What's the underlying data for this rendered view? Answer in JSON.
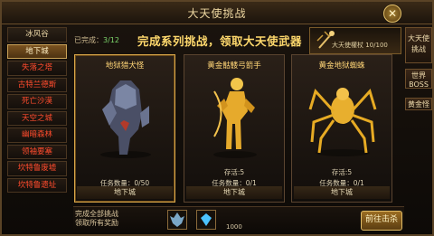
{
  "window": {
    "title": "大天使挑战"
  },
  "sidebar": {
    "items": [
      {
        "label": "冰风谷"
      },
      {
        "label": "地下城"
      },
      {
        "label": "失落之塔"
      },
      {
        "label": "古特兰德斯"
      },
      {
        "label": "死亡沙漠"
      },
      {
        "label": "天空之城"
      },
      {
        "label": "幽暗森林"
      },
      {
        "label": "领袖要塞"
      },
      {
        "label": "坎特鲁废墟"
      },
      {
        "label": "坎特鲁遗址"
      }
    ]
  },
  "header": {
    "progress_label": "已完成：",
    "progress_value": "3/12",
    "banner": "完成系列挑战，领取大天使武器",
    "reward_label": "大天使權杖 10/100"
  },
  "cards": [
    {
      "name": "地狱猎犬怪",
      "task": "任务数量：0/50",
      "map": "地下城"
    },
    {
      "name": "黄金骷髅弓箭手",
      "survive": "存活:5",
      "task": "任务数量：0/1",
      "map": "地下城"
    },
    {
      "name": "黄金地狱蜘蛛",
      "survive": "存活:5",
      "task": "任务数量：0/1",
      "map": "地下城"
    }
  ],
  "right_panel": {
    "btn1": "大天使挑战",
    "btn2": "世界BOSS",
    "btn3": "黄金怪"
  },
  "bottom": {
    "line1": "完成全部挑战",
    "line2": "领取所有奖励",
    "qty2": "1000",
    "go_button": "前往击杀"
  },
  "colors": {
    "accent_gold": "#ffd96d",
    "warning_red": "#ff4b2d",
    "progress_green": "#7cd66b"
  }
}
